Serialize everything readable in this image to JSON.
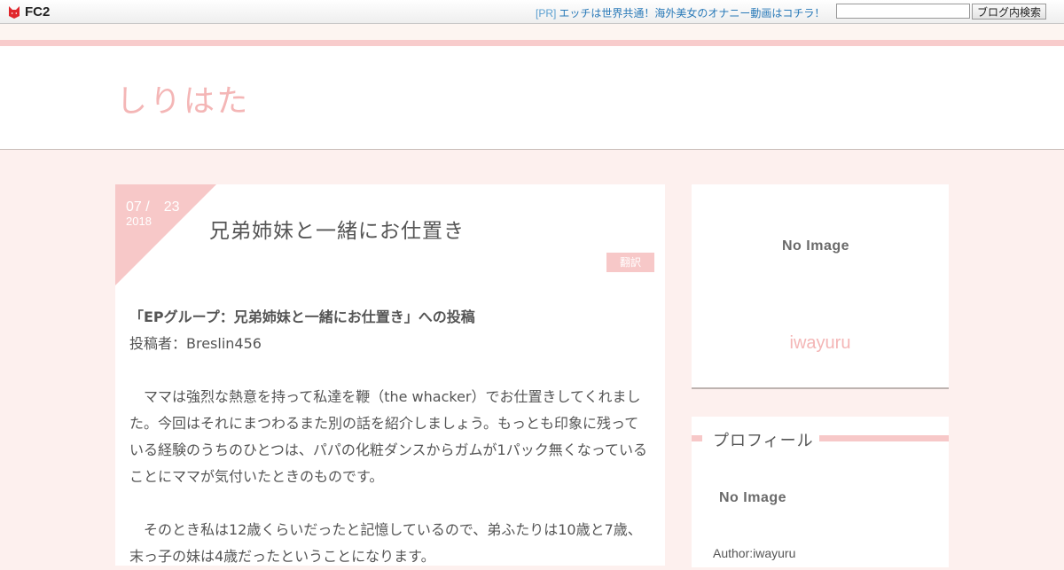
{
  "topbar": {
    "logo_text": "FC2",
    "pr_tag": "[PR]",
    "pr_text": "エッチは世界共通！海外美女のオナニー動画はコチラ！",
    "search_value": "",
    "search_button": "ブログ内検索"
  },
  "header": {
    "blog_title": "しりはた"
  },
  "entry": {
    "date_md": "07 /　23",
    "date_year": "2018",
    "title": "兄弟姉妹と一緒にお仕置き",
    "category": "翻訳",
    "lead": "「EPグループ：兄弟姉妹と一緒にお仕置き」への投稿",
    "poster": "投稿者：Breslin456",
    "para1_line1": "ママは強烈な熱意を持って私達を鞭（the whacker）でお仕置きしてくれまし",
    "para1_line2": "た。今回はそれにまつわるまた別の話を紹介しましょう。もっとも印象に残って",
    "para1_line3": "いる経験のうちのひとつは、パパの化粧ダンスからガムが1パック無くなっている",
    "para1_line4": "ことにママが気付いたときのものです。",
    "para2_line1": "そのとき私は12歳くらいだったと記憶しているので、弟ふたりは10歳と7歳、",
    "para2_line2": "末っ子の妹は4歳だったということになります。"
  },
  "sidebar": {
    "top_noimage": "No Image",
    "top_name": "iwayuru",
    "profile_heading": "プロフィール",
    "profile_noimage": "No Image",
    "profile_author": "Author:iwayuru"
  },
  "colors": {
    "accent_pink": "#f7c8c8",
    "title_pink": "#f4b6b6",
    "page_bg": "#fdf0ee",
    "pr_link_blue": "#2a7ab8"
  },
  "icons": {
    "fc2_logo": "fc2-fox-logo-icon"
  }
}
